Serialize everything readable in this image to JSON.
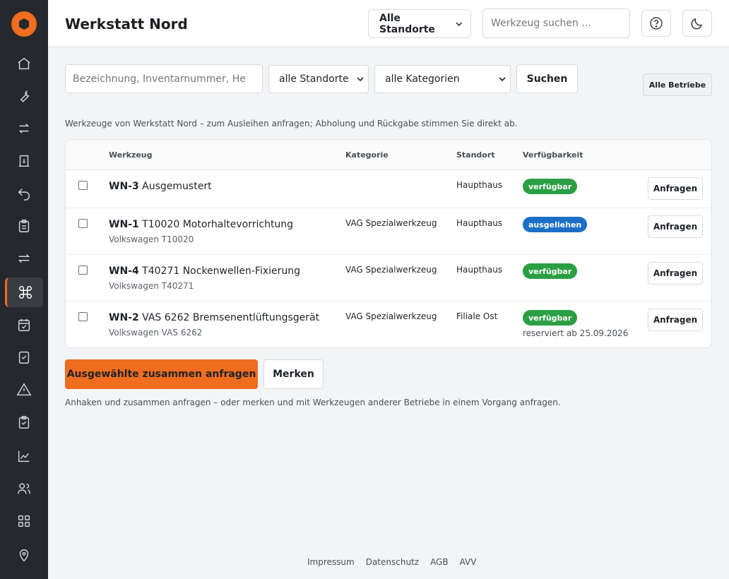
{
  "header": {
    "title": "Werkstatt Nord",
    "location_select": "Alle Standorte",
    "search_placeholder": "Werkzeug suchen ..."
  },
  "sidebar": {
    "items": [
      {
        "icon": "home-icon"
      },
      {
        "icon": "wrench-icon"
      },
      {
        "icon": "transfer-icon"
      },
      {
        "icon": "receipt-icon"
      },
      {
        "icon": "return-icon"
      },
      {
        "icon": "clipboard-icon"
      },
      {
        "icon": "exchange-icon"
      },
      {
        "icon": "command-icon",
        "active": true
      },
      {
        "icon": "calendar-check-icon"
      },
      {
        "icon": "checkbox-icon"
      },
      {
        "icon": "warning-icon"
      },
      {
        "icon": "clipboard-check-icon"
      },
      {
        "icon": "chart-icon"
      },
      {
        "icon": "users-icon"
      },
      {
        "icon": "grid-icon"
      },
      {
        "icon": "location-pin-icon"
      }
    ]
  },
  "filters": {
    "search_placeholder": "Bezeichnung, Inventarnummer, He",
    "location": "alle Standorte",
    "category": "alle Kategorien",
    "search_button": "Suchen",
    "all_companies_button": "Alle Betriebe"
  },
  "intro": "Werkzeuge von Werkstatt Nord – zum Ausleihen anfragen; Abholung und Rückgabe stimmen Sie direkt ab.",
  "table": {
    "headers": {
      "tool": "Werkzeug",
      "category": "Kategorie",
      "location": "Standort",
      "availability": "Verfügbarkeit"
    },
    "rows": [
      {
        "id": "WN-3",
        "name": "Ausgemustert",
        "sub": "",
        "category": "",
        "location": "Haupthaus",
        "status": "verfügbar",
        "status_color": "#2a9f44",
        "note": "",
        "action": "Anfragen"
      },
      {
        "id": "WN-1",
        "name": "T10020 Motorhaltevorrichtung",
        "sub": "Volkswagen T10020",
        "category": "VAG Spezialwerkzeug",
        "location": "Haupthaus",
        "status": "ausgeliehen",
        "status_color": "#1c6fc7",
        "note": "",
        "action": "Anfragen"
      },
      {
        "id": "WN-4",
        "name": "T40271 Nockenwellen-Fixierung",
        "sub": "Volkswagen T40271",
        "category": "VAG Spezialwerkzeug",
        "location": "Haupthaus",
        "status": "verfügbar",
        "status_color": "#2a9f44",
        "note": "",
        "action": "Anfragen"
      },
      {
        "id": "WN-2",
        "name": "VAS 6262 Bremsenentlüftungsgerät",
        "sub": "Volkswagen VAS 6262",
        "category": "VAG Spezialwerkzeug",
        "location": "Filiale Ost",
        "status": "verfügbar",
        "status_color": "#2a9f44",
        "note": "reserviert ab 25.09.2026",
        "action": "Anfragen"
      }
    ]
  },
  "actions": {
    "request_selected": "Ausgewählte zusammen anfragen",
    "remember": "Merken",
    "hint": "Anhaken und zusammen anfragen – oder merken und mit Werkzeugen anderer Betriebe in einem Vorgang anfragen."
  },
  "footer": {
    "links": [
      "Impressum",
      "Datenschutz",
      "AGB",
      "AVV"
    ]
  },
  "colors": {
    "accent": "#f06c1f",
    "sidebar": "#25282c",
    "available": "#2a9f44",
    "borrowed": "#1c6fc7"
  }
}
